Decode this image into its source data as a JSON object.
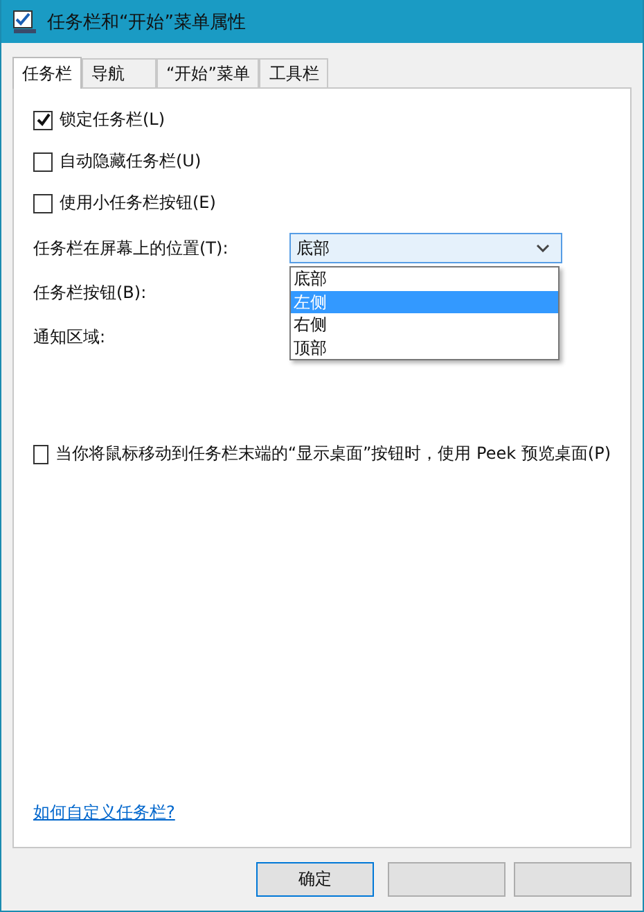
{
  "window": {
    "title": "任务栏和“开始”菜单属性"
  },
  "tabs": [
    {
      "label": "任务栏",
      "selected": true
    },
    {
      "label": "导航",
      "selected": false
    },
    {
      "label": "“开始”菜单",
      "selected": false
    },
    {
      "label": "工具栏",
      "selected": false
    }
  ],
  "options": [
    {
      "label": "锁定任务栏(L)",
      "checked": true
    },
    {
      "label": "自动隐藏任务栏(U)",
      "checked": false
    },
    {
      "label": "使用小任务栏按钮(E)",
      "checked": false
    }
  ],
  "position": {
    "label": "任务栏在屏幕上的位置(T):",
    "value": "底部",
    "expanded": true,
    "list": [
      {
        "label": "底部",
        "highlighted": false
      },
      {
        "label": "左侧",
        "highlighted": true
      },
      {
        "label": "右侧",
        "highlighted": false
      },
      {
        "label": "顶部",
        "highlighted": false
      }
    ]
  },
  "labels": [
    "任务栏按钮(B):",
    "通知区域:"
  ],
  "peek": {
    "label": "当你将鼠标移动到任务栏末端的“显示桌面”按钮时，使用 Peek 预览桌面(P)",
    "checked": false
  },
  "help_link": "如何自定义任务栏?",
  "buttons": [
    {
      "label": "确定"
    }
  ]
}
